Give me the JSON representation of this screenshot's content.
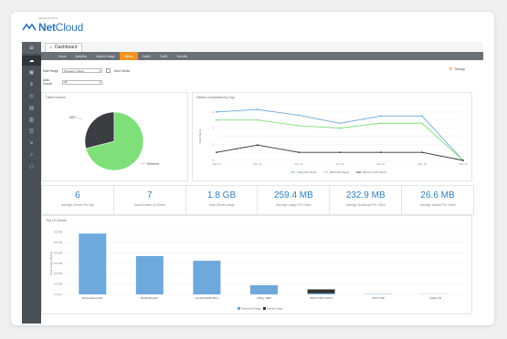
{
  "brand": {
    "small_text": "CRADLEPOINT",
    "name_bold": "Net",
    "name_light": "Cloud"
  },
  "tabs": {
    "dashboard": "Dashboard"
  },
  "nav": {
    "items": [
      {
        "label": "Home",
        "active": false
      },
      {
        "label": "Activities",
        "active": false
      },
      {
        "label": "Modem Usage",
        "active": false
      },
      {
        "label": "Clients",
        "active": true
      },
      {
        "label": "Health",
        "active": false
      },
      {
        "label": "Traffic",
        "active": false
      },
      {
        "label": "Security",
        "active": false
      }
    ]
  },
  "sidebar": {
    "icons": [
      "home-icon",
      "cloud-icon",
      "devices-icon",
      "network-icon",
      "globe-icon",
      "document-icon",
      "report-icon",
      "list-icon",
      "tools-icon",
      "search-icon",
      "user-icon"
    ]
  },
  "filters": {
    "date_range_label": "Date Range",
    "date_range_value": "Previous 7 Days",
    "new_clients_label": "New Clients",
    "data_source_label": "Data Source",
    "data_source_value": "All",
    "settings_label": "Settings"
  },
  "client_source": {
    "title": "Client Source",
    "slices_label_left": "WiFi",
    "slices_label_right": "Ethernet"
  },
  "connected_by_day": {
    "title": "Clients Connected by Day",
    "ylabel": "Total Clients",
    "legend": [
      "Total LAN Clients",
      "WiFi LAN Clients",
      "Ethernet LAN Clients"
    ]
  },
  "stats": [
    {
      "value": "6",
      "label": "Average Clients Per Day"
    },
    {
      "value": "7",
      "label": "Total Number of Clients"
    },
    {
      "value": "1.8 GB",
      "label": "Total Clients Usage"
    },
    {
      "value": "259.4 MB",
      "label": "Average Usage Per Client"
    },
    {
      "value": "232.9 MB",
      "label": "Average Download Per Client"
    },
    {
      "value": "26.6 MB",
      "label": "Average Upload Per Client"
    }
  ],
  "top_clients": {
    "title": "Top 10 Clients",
    "ylabel": "Data Usage (Bytes)",
    "legend": [
      "Download Usage",
      "Upload Usage"
    ]
  },
  "colors": {
    "accent": "#f0941f",
    "blue": "#2e7fbf",
    "pie_green": "#7fe07a",
    "pie_dark": "#3a3d42",
    "bar_blue": "#6fa8dc",
    "bar_dark": "#333"
  },
  "chart_data": [
    {
      "type": "pie",
      "title": "Client Source",
      "labels": [
        "Ethernet",
        "WiFi"
      ],
      "values": [
        71,
        29
      ]
    },
    {
      "type": "line",
      "title": "Clients Connected by Day",
      "x": [
        "Dec 13",
        "Dec 14",
        "Dec 15",
        "Dec 16",
        "Dec 17",
        "Dec 18",
        "Dec 19"
      ],
      "ylabel": "Total Clients",
      "ylim": [
        0,
        7
      ],
      "series": [
        {
          "name": "Total LAN Clients",
          "values": [
            6,
            6.3,
            5.6,
            4.6,
            5.5,
            5.5,
            0
          ]
        },
        {
          "name": "WiFi LAN Clients",
          "values": [
            5,
            5,
            4.3,
            4,
            4.6,
            4.6,
            0
          ]
        },
        {
          "name": "Ethernet LAN Clients",
          "values": [
            1,
            1.9,
            1,
            1,
            1,
            1,
            0
          ]
        }
      ]
    },
    {
      "type": "bar",
      "title": "Top 10 Clients",
      "ylabel": "Data Usage (Bytes)",
      "categories": [
        "WindowsServer01",
        "BenDesktopPC",
        "JenniferMacBookPro",
        "Jeffrey- MBP",
        "AMC72:58A:1A0C9",
        "APCC-006",
        "Galaxy-S9"
      ],
      "series": [
        {
          "name": "Download Usage",
          "values": [
            586,
            369,
            324,
            88,
            10,
            3,
            2
          ]
        },
        {
          "name": "Upload Usage",
          "values": [
            0,
            0,
            0,
            0,
            38,
            0,
            0
          ]
        }
      ]
    }
  ]
}
